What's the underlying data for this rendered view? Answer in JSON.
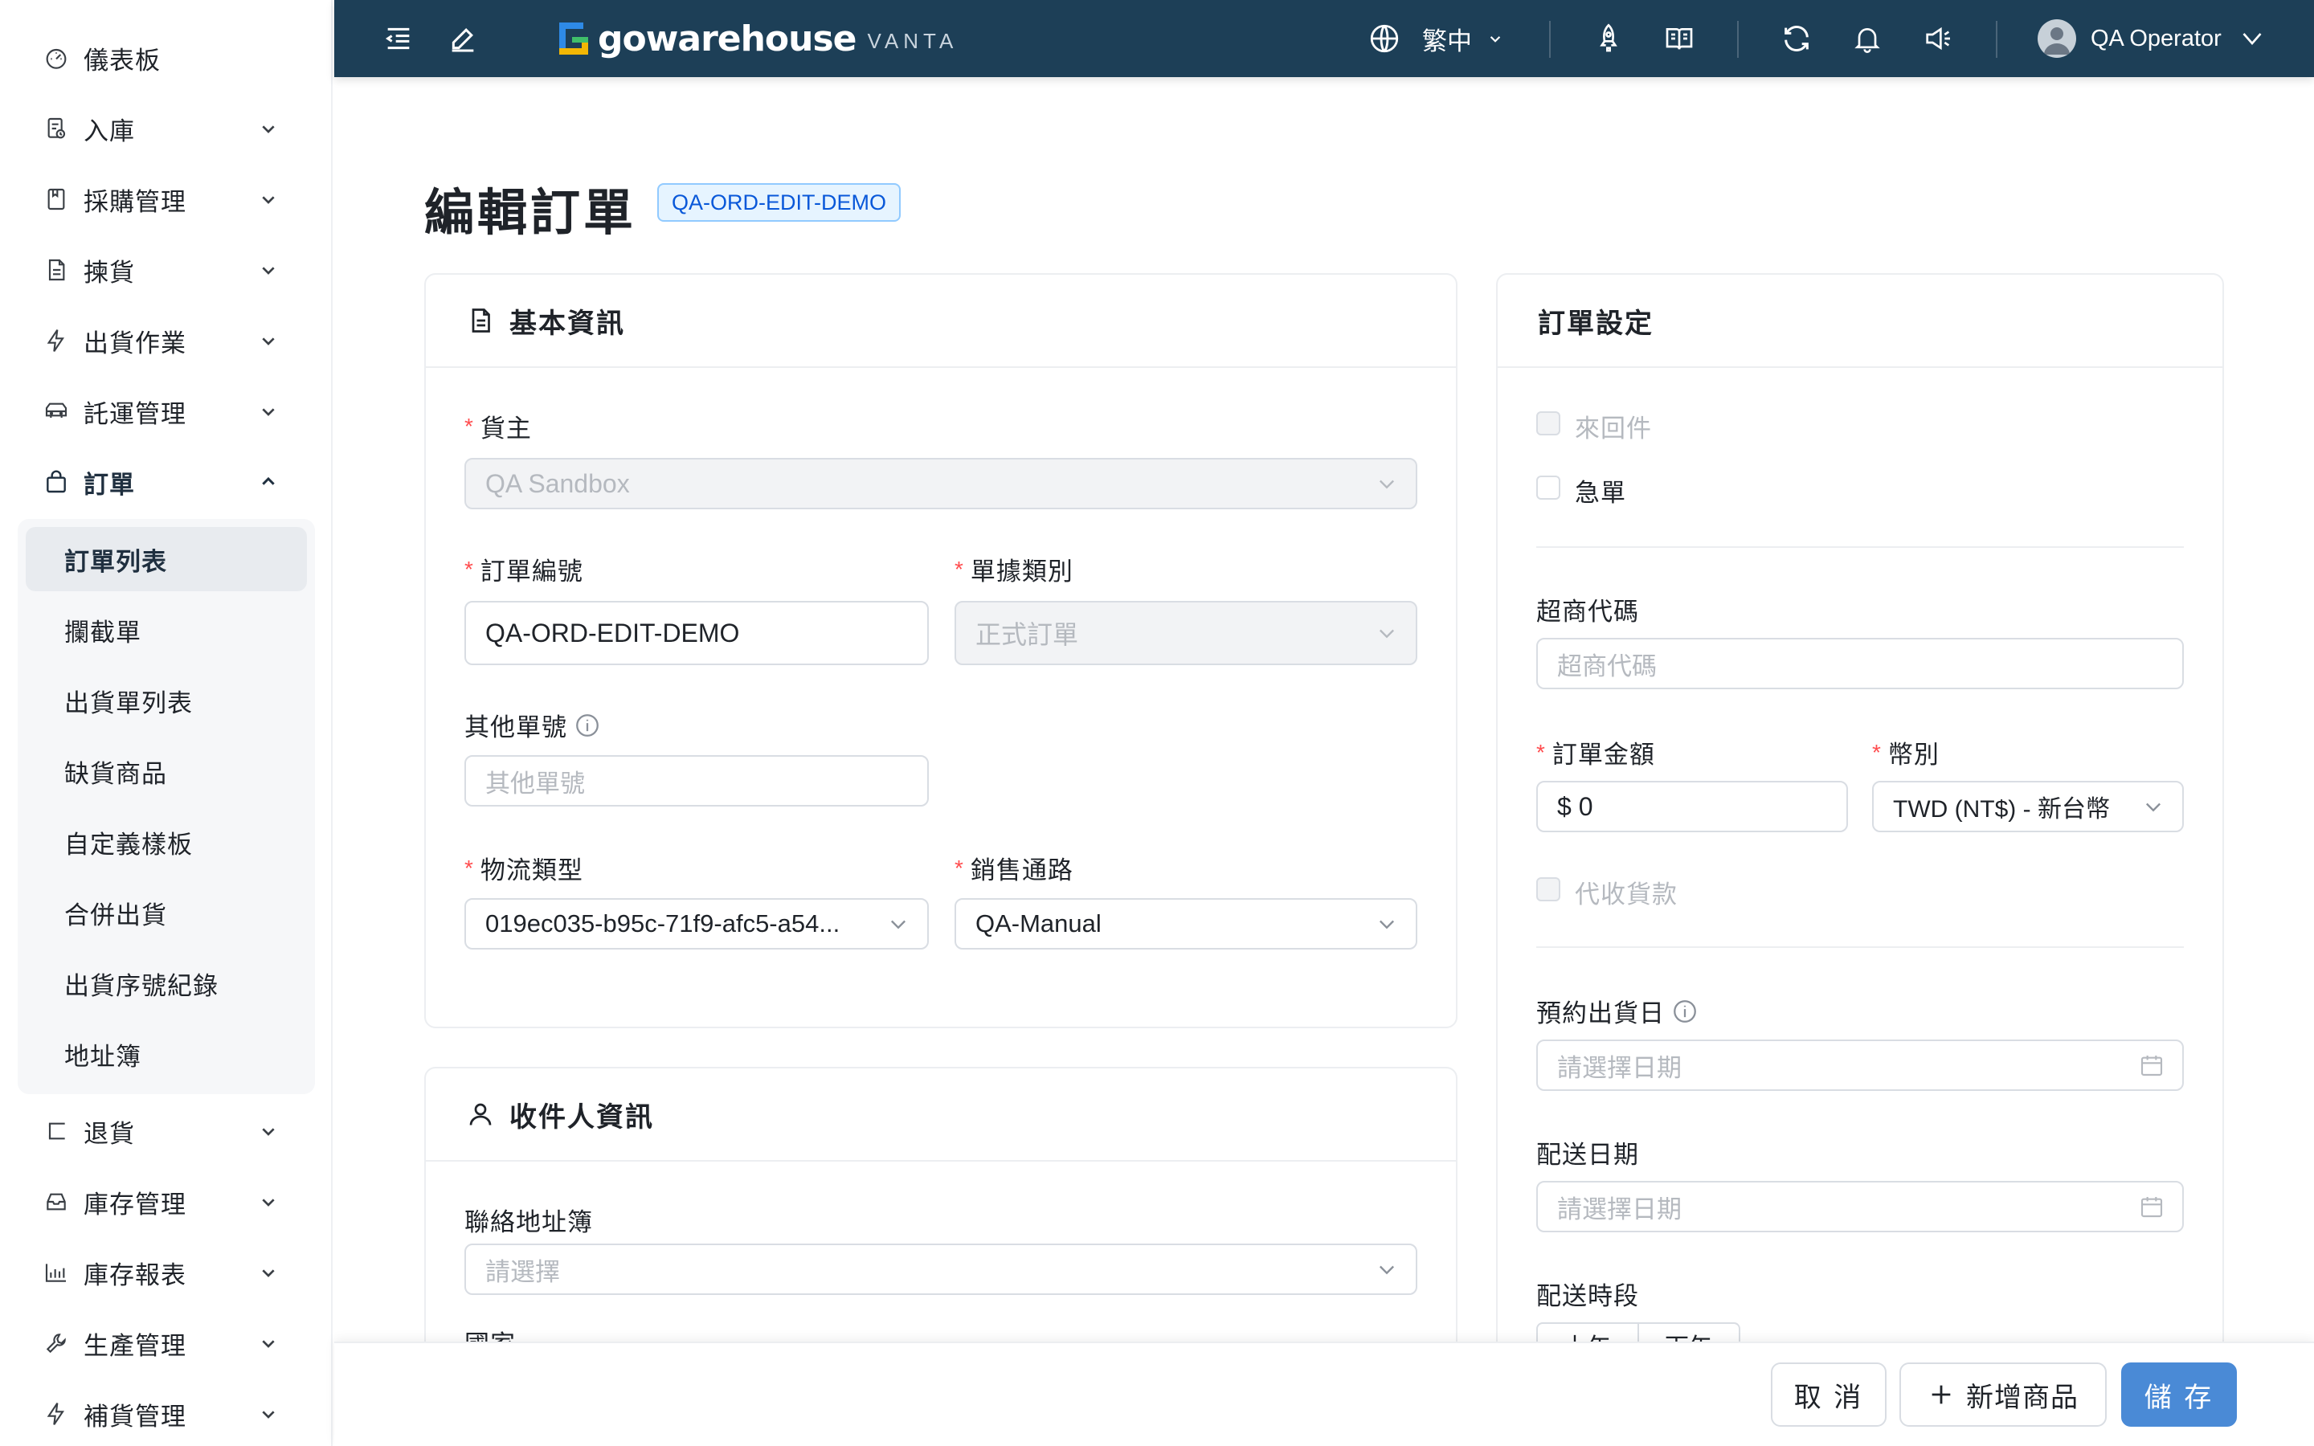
{
  "sidebar": {
    "items": [
      {
        "label": "儀表板",
        "icon": "dashboard-icon"
      },
      {
        "label": "入庫",
        "icon": "inbound-icon"
      },
      {
        "label": "採購管理",
        "icon": "purchase-icon"
      },
      {
        "label": "揀貨",
        "icon": "picking-icon"
      },
      {
        "label": "出貨作業",
        "icon": "lightning-icon"
      },
      {
        "label": "託運管理",
        "icon": "truck-icon"
      },
      {
        "label": "訂單",
        "icon": "bag-icon"
      },
      {
        "label": "退貨",
        "icon": "return-icon"
      },
      {
        "label": "庫存管理",
        "icon": "inventory-icon"
      },
      {
        "label": "庫存報表",
        "icon": "chart-icon"
      },
      {
        "label": "生產管理",
        "icon": "wrench-icon"
      },
      {
        "label": "補貨管理",
        "icon": "lightning-icon"
      }
    ],
    "order_submenu": [
      "訂單列表",
      "攔截單",
      "出貨單列表",
      "缺貨商品",
      "自定義樣板",
      "合併出貨",
      "出貨序號紀錄",
      "地址簿"
    ]
  },
  "topbar": {
    "logo_text": "gowarehouse",
    "logo_sub": "VANTA",
    "language": "繁中",
    "user_name": "QA Operator"
  },
  "page": {
    "title": "編輯訂單",
    "order_tag": "QA-ORD-EDIT-DEMO"
  },
  "basic": {
    "heading": "基本資訊",
    "owner_label": "貨主",
    "owner_value": "QA Sandbox",
    "order_no_label": "訂單編號",
    "order_no_value": "QA-ORD-EDIT-DEMO",
    "doc_type_label": "單據類別",
    "doc_type_value": "正式訂單",
    "other_no_label": "其他單號",
    "other_no_placeholder": "其他單號",
    "logistics_label": "物流類型",
    "logistics_value": "019ec035-b95c-71f9-afc5-a54...",
    "channel_label": "銷售通路",
    "channel_value": "QA-Manual"
  },
  "recipient": {
    "heading": "收件人資訊",
    "address_book_label": "聯絡地址簿",
    "address_book_placeholder": "請選擇",
    "country_label": "國家"
  },
  "settings": {
    "heading": "訂單設定",
    "roundtrip_label": "來回件",
    "urgent_label": "急單",
    "store_code_label": "超商代碼",
    "store_code_placeholder": "超商代碼",
    "amount_label": "訂單金額",
    "amount_value": "$ 0",
    "currency_label": "幣別",
    "currency_value": "TWD (NT$) - 新台幣",
    "cod_label": "代收貨款",
    "ship_date_label": "預約出貨日",
    "ship_date_placeholder": "請選擇日期",
    "delivery_date_label": "配送日期",
    "delivery_date_placeholder": "請選擇日期",
    "time_slot_label": "配送時段",
    "time_slots": [
      "上午",
      "下午"
    ]
  },
  "footer": {
    "cancel": "取 消",
    "add_product": "新增商品",
    "save": "儲 存"
  },
  "colors": {
    "topbar_bg": "#1d3f57",
    "primary": "#4a8ad6",
    "tag_bg": "#e6f4ff",
    "required": "#ff4d4f"
  }
}
